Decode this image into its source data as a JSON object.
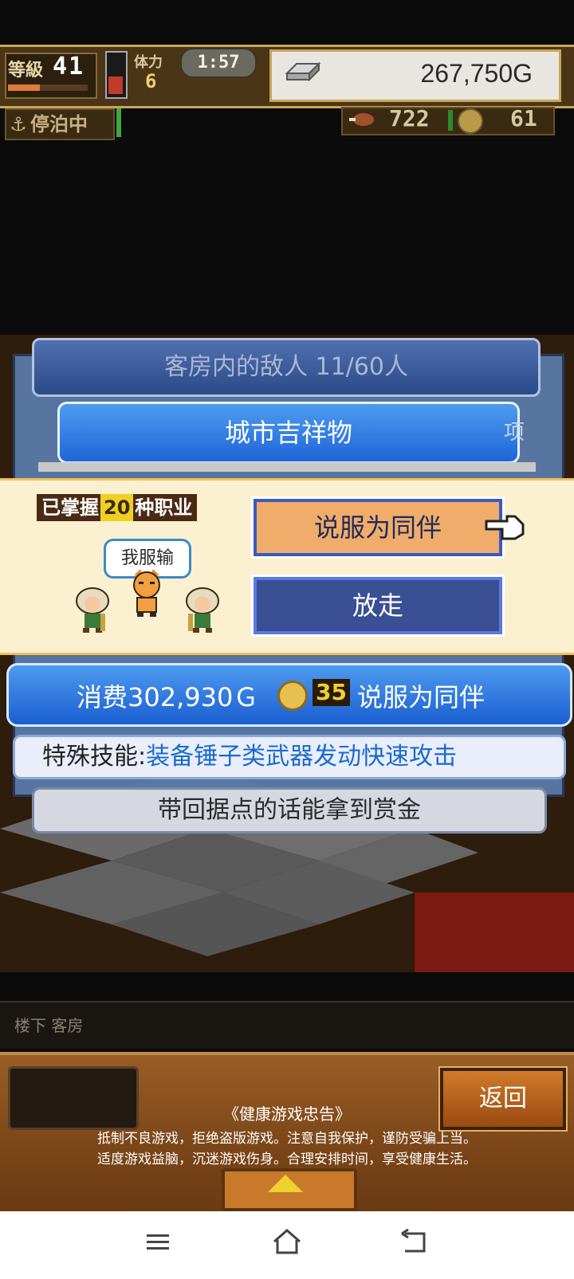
{
  "status": {
    "level_label": "等級",
    "level_value": "41",
    "stamina_label": "体力",
    "stamina_value": "6",
    "timer": "1:57",
    "gold": "267,750G",
    "docked_label": "停泊中",
    "meat_count": "722",
    "coin_count": "61"
  },
  "panel": {
    "enemies_title": "客房内的敌人  11/60人",
    "mascot_title": "城市吉祥物",
    "side_hint": "项"
  },
  "recruit": {
    "mastered_prefix": "已掌握",
    "mastered_count": "20",
    "mastered_suffix": "种职业",
    "speech": "我服输",
    "persuade_button": "说服为同伴",
    "leave_button": "放走"
  },
  "cost": {
    "prefix": "消费302,930Ｇ",
    "medal_value": "35",
    "suffix": "说服为同伴"
  },
  "skill": {
    "label": "特殊技能:",
    "value": "装备锤子类武器发动快速攻击"
  },
  "bounty_text": "带回据点的话能拿到赏金",
  "location": "楼下 客房",
  "bottom": {
    "back_button": "返回",
    "health_title": "《健康游戏忠告》",
    "health_line1": "抵制不良游戏，拒绝盗版游戏。注意自我保护，谨防受骗上当。",
    "health_line2": "适度游戏益脑，沉迷游戏伤身。合理安排时间，享受健康生活。"
  },
  "colors": {
    "accent_blue": "#1e66d8",
    "gold_border": "#c9a55a",
    "popup_bg": "#fbf1d0",
    "recruit_btn": "#f0ac6a",
    "leave_btn": "#3a4f94",
    "skill_blue": "#1a6ad0"
  },
  "icons": [
    "gold-bar-icon",
    "anchor-icon",
    "meat-icon",
    "coin-icon",
    "pointing-hand-icon",
    "up-arrow-icon",
    "menu-icon",
    "home-icon",
    "back-icon"
  ]
}
